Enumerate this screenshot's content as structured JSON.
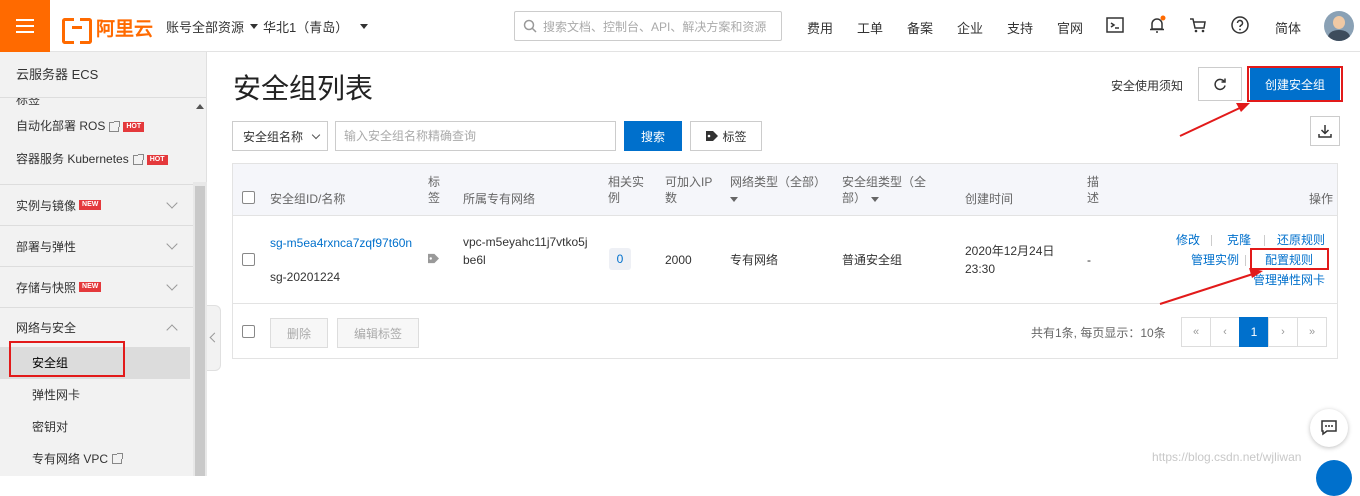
{
  "topbar": {
    "logo_text": "阿里云",
    "account_dd": "账号全部资源",
    "region_dd": "华北1（青岛）",
    "search_placeholder": "搜索文档、控制台、API、解决方案和资源",
    "nav": [
      "费用",
      "工单",
      "备案",
      "企业",
      "支持",
      "官网"
    ],
    "lang": "简体",
    "icons": [
      "terminal-icon",
      "bell-icon",
      "cart-icon",
      "help-icon"
    ],
    "brand_color": "#ff6a00"
  },
  "sidebar": {
    "title": "云服务器 ECS",
    "clipped_item": "标签",
    "links": [
      {
        "label": "自动化部署 ROS",
        "badge": "HOT"
      },
      {
        "label": "容器服务 Kubernetes",
        "badge": "HOT"
      }
    ],
    "groups": [
      {
        "label": "实例与镜像",
        "badge": "NEW"
      },
      {
        "label": "部署与弹性",
        "badge": ""
      },
      {
        "label": "存储与快照",
        "badge": "NEW"
      },
      {
        "label": "网络与安全",
        "badge": ""
      }
    ],
    "sub_items": [
      "安全组",
      "弹性网卡",
      "密钥对",
      "专有网络 VPC"
    ]
  },
  "main": {
    "title": "安全组列表",
    "notice_link": "安全使用须知",
    "create_button": "创建安全组",
    "filter_select": "安全组名称",
    "filter_placeholder": "输入安全组名称精确查询",
    "search_button": "搜索",
    "tag_button": "标签",
    "table": {
      "headers": {
        "id": "安全组ID/名称",
        "tag": "标签",
        "vpc": "所属专有网络",
        "instances": "相关实例",
        "ip": "可加入IP数",
        "net_type": "网络类型（全部）",
        "sg_type": "安全组类型（全部）",
        "created": "创建时间",
        "desc": "描述",
        "ops": "操作"
      },
      "rows": [
        {
          "id": "sg-m5ea4rxnca7zqf97t60n",
          "name": "sg-20201224",
          "vpc": "vpc-m5eyahc11j7vtko5jbe6l",
          "instances": "0",
          "ip": "2000",
          "net_type": "专有网络",
          "sg_type": "普通安全组",
          "created": "2020年12月24日 23:30",
          "desc": "-",
          "ops": [
            "修改",
            "克隆",
            "还原规则",
            "管理实例",
            "配置规则",
            "管理弹性网卡"
          ]
        }
      ]
    },
    "delete_button": "删除",
    "edit_tag_button": "编辑标签",
    "pager_info": "共有1条, 每页显示：10条",
    "pager": [
      "«",
      "‹",
      "1",
      "›",
      "»"
    ],
    "current_page": "1"
  },
  "watermark": "https://blog.csdn.net/wjliwan",
  "accent_color": "#0070cc",
  "highlight_color": "#e21a1a"
}
